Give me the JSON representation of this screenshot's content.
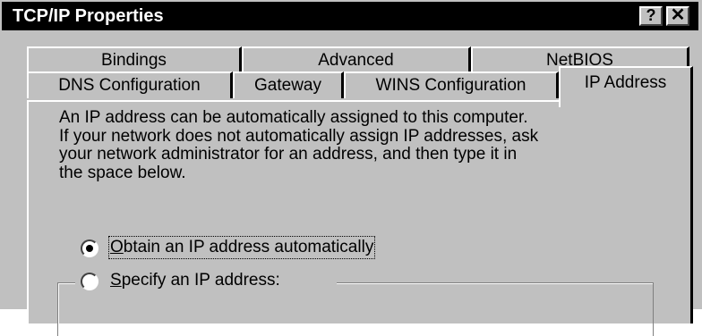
{
  "window": {
    "title": "TCP/IP Properties",
    "help_button": "?",
    "close_button": "✕"
  },
  "tabs": {
    "row1": [
      {
        "label": "Bindings"
      },
      {
        "label": "Advanced"
      },
      {
        "label": "NetBIOS"
      }
    ],
    "row2": [
      {
        "label": "DNS Configuration"
      },
      {
        "label": "Gateway"
      },
      {
        "label": "WINS Configuration"
      },
      {
        "label": "IP Address",
        "active": true
      }
    ]
  },
  "panel": {
    "description_lines": [
      "An IP address can be automatically assigned to this computer.",
      "If your network does not automatically assign IP addresses, ask",
      "your network administrator for an address, and then type it in",
      "the space below."
    ],
    "options": [
      {
        "label": "Obtain an IP address automatically",
        "selected": true,
        "mnemonic": "O"
      },
      {
        "label": "Specify an IP address:",
        "selected": false,
        "mnemonic": "S"
      }
    ]
  }
}
